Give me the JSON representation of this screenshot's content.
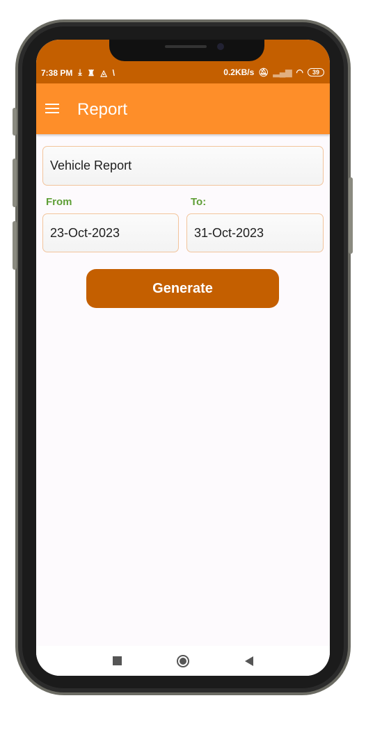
{
  "status_bar": {
    "time": "7:38 PM",
    "speed": "0.2KB/s",
    "battery": "39"
  },
  "app_bar": {
    "title": "Report"
  },
  "form": {
    "report_type": "Vehicle Report",
    "from_label": "From",
    "from_value": "23-Oct-2023",
    "to_label": "To:",
    "to_value": "31-Oct-2023",
    "generate_label": "Generate"
  },
  "colors": {
    "status": "#c45f00",
    "appbar": "#fe8e29",
    "button": "#c45f00",
    "label": "#5e9e36"
  }
}
